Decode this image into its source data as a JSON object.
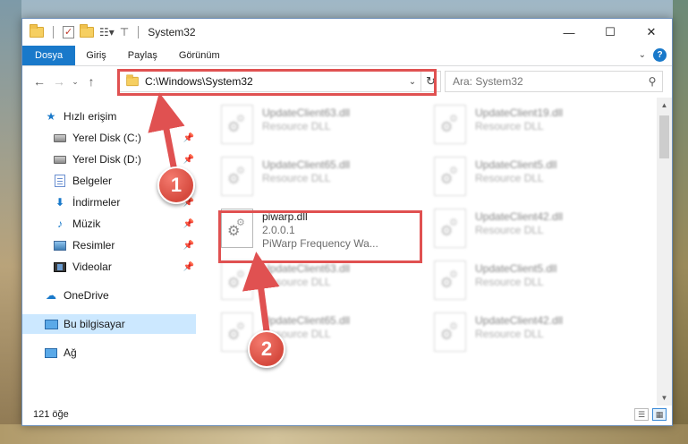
{
  "window": {
    "title": "System32",
    "controls": {
      "minimize": "—",
      "maximize": "☐",
      "close": "✕"
    }
  },
  "ribbon": {
    "tabs": [
      {
        "label": "Dosya"
      },
      {
        "label": "Giriş"
      },
      {
        "label": "Paylaş"
      },
      {
        "label": "Görünüm"
      }
    ],
    "help": "?"
  },
  "nav": {
    "back": "←",
    "forward": "→",
    "recent": "⌄",
    "up": "↑",
    "address": "C:\\Windows\\System32",
    "search_placeholder": "Ara: System32"
  },
  "sidebar": {
    "items": [
      {
        "label": "Hızlı erişim",
        "icon": "star-icon",
        "pinned": false
      },
      {
        "label": "Yerel Disk (C:)",
        "icon": "drive-icon",
        "pinned": true
      },
      {
        "label": "Yerel Disk (D:)",
        "icon": "drive-icon",
        "pinned": true
      },
      {
        "label": "Belgeler",
        "icon": "documents-icon",
        "pinned": true
      },
      {
        "label": "İndirmeler",
        "icon": "downloads-icon",
        "pinned": true
      },
      {
        "label": "Müzik",
        "icon": "music-icon",
        "pinned": true
      },
      {
        "label": "Resimler",
        "icon": "pictures-icon",
        "pinned": true
      },
      {
        "label": "Videolar",
        "icon": "videos-icon",
        "pinned": true
      },
      {
        "label": "OneDrive",
        "icon": "cloud-icon",
        "pinned": false
      },
      {
        "label": "Bu bilgisayar",
        "icon": "computer-icon",
        "pinned": false,
        "selected": true
      },
      {
        "label": "Ağ",
        "icon": "network-icon",
        "pinned": false
      }
    ]
  },
  "files": [
    {
      "name": "UpdateClient63.dll",
      "sub": "Resource DLL",
      "blurred": true
    },
    {
      "name": "UpdateClient19.dll",
      "sub": "Resource DLL",
      "blurred": true
    },
    {
      "name": "UpdateClient65.dll",
      "sub": "Resource DLL",
      "blurred": true
    },
    {
      "name": "UpdateClient5.dll",
      "sub": "Resource DLL",
      "blurred": true
    },
    {
      "name": "piwarp.dll",
      "version": "2.0.0.1",
      "sub": "PiWarp Frequency Wa...",
      "blurred": false
    },
    {
      "name": "UpdateClient42.dll",
      "sub": "Resource DLL",
      "blurred": true
    },
    {
      "name": "UpdateClient63.dll",
      "sub": "Resource DLL",
      "blurred": true
    },
    {
      "name": "UpdateClient5.dll",
      "sub": "Resource DLL",
      "blurred": true
    },
    {
      "name": "UpdateClient65.dll",
      "sub": "Resource DLL",
      "blurred": true
    },
    {
      "name": "UpdateClient42.dll",
      "sub": "Resource DLL",
      "blurred": true
    }
  ],
  "status": {
    "count": "121 öğe"
  },
  "annotations": {
    "marker1": "1",
    "marker2": "2",
    "color": "#e05151"
  }
}
